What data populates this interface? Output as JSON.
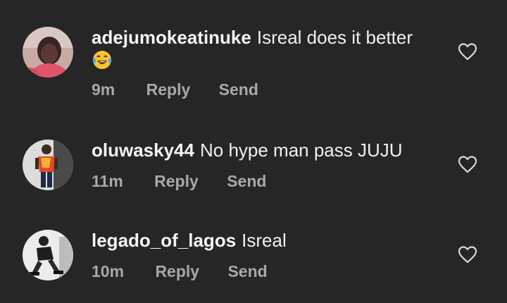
{
  "colors": {
    "background": "#262626",
    "primary_text": "#f5f5f5",
    "secondary_text": "#a8a8a8"
  },
  "comments": [
    {
      "username": "adejumokeatinuke",
      "text": "Isreal does it better",
      "emoji": "face-with-tears-of-joy",
      "time": "9m",
      "reply_label": "Reply",
      "send_label": "Send",
      "like_icon": "heart-outline-icon"
    },
    {
      "username": "oluwasky44",
      "text": "No hype man pass JUJU",
      "time": "11m",
      "reply_label": "Reply",
      "send_label": "Send",
      "like_icon": "heart-outline-icon"
    },
    {
      "username": "legado_of_lagos",
      "text": "Isreal",
      "time": "10m",
      "reply_label": "Reply",
      "send_label": "Send",
      "like_icon": "heart-outline-icon"
    }
  ]
}
